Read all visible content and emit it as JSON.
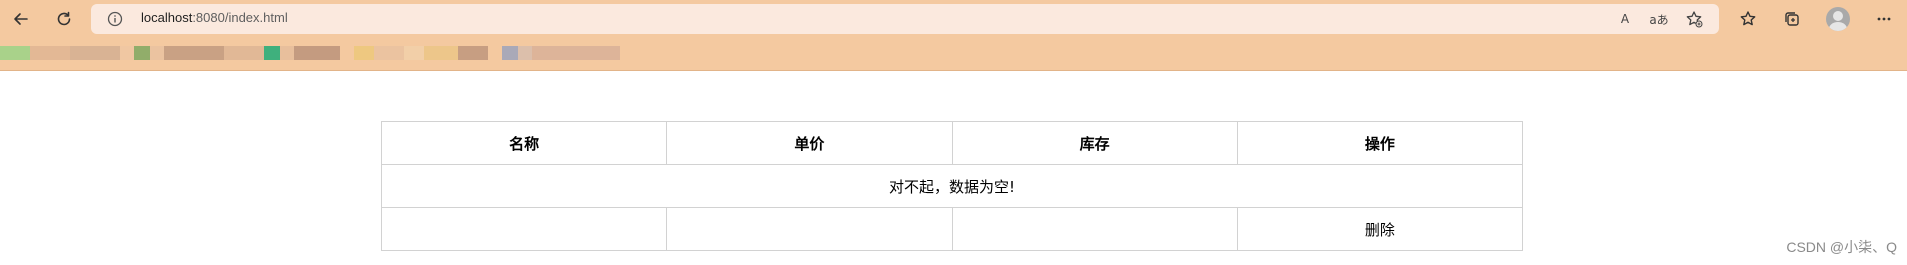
{
  "browser": {
    "url_host": "localhost",
    "url_rest": ":8080/index.html",
    "read_aloud_glyph": "A",
    "translate_glyph": "aあ"
  },
  "table": {
    "headers": [
      "名称",
      "单价",
      "库存",
      "操作"
    ],
    "empty_message": "对不起，数据为空!",
    "delete_label": "删除"
  },
  "watermark": "CSDN @小柒、Q",
  "colors": {
    "toolbar_bg": "#f4c9a0",
    "address_bg": "#fbe9de",
    "table_border": "#d2d2d2"
  }
}
